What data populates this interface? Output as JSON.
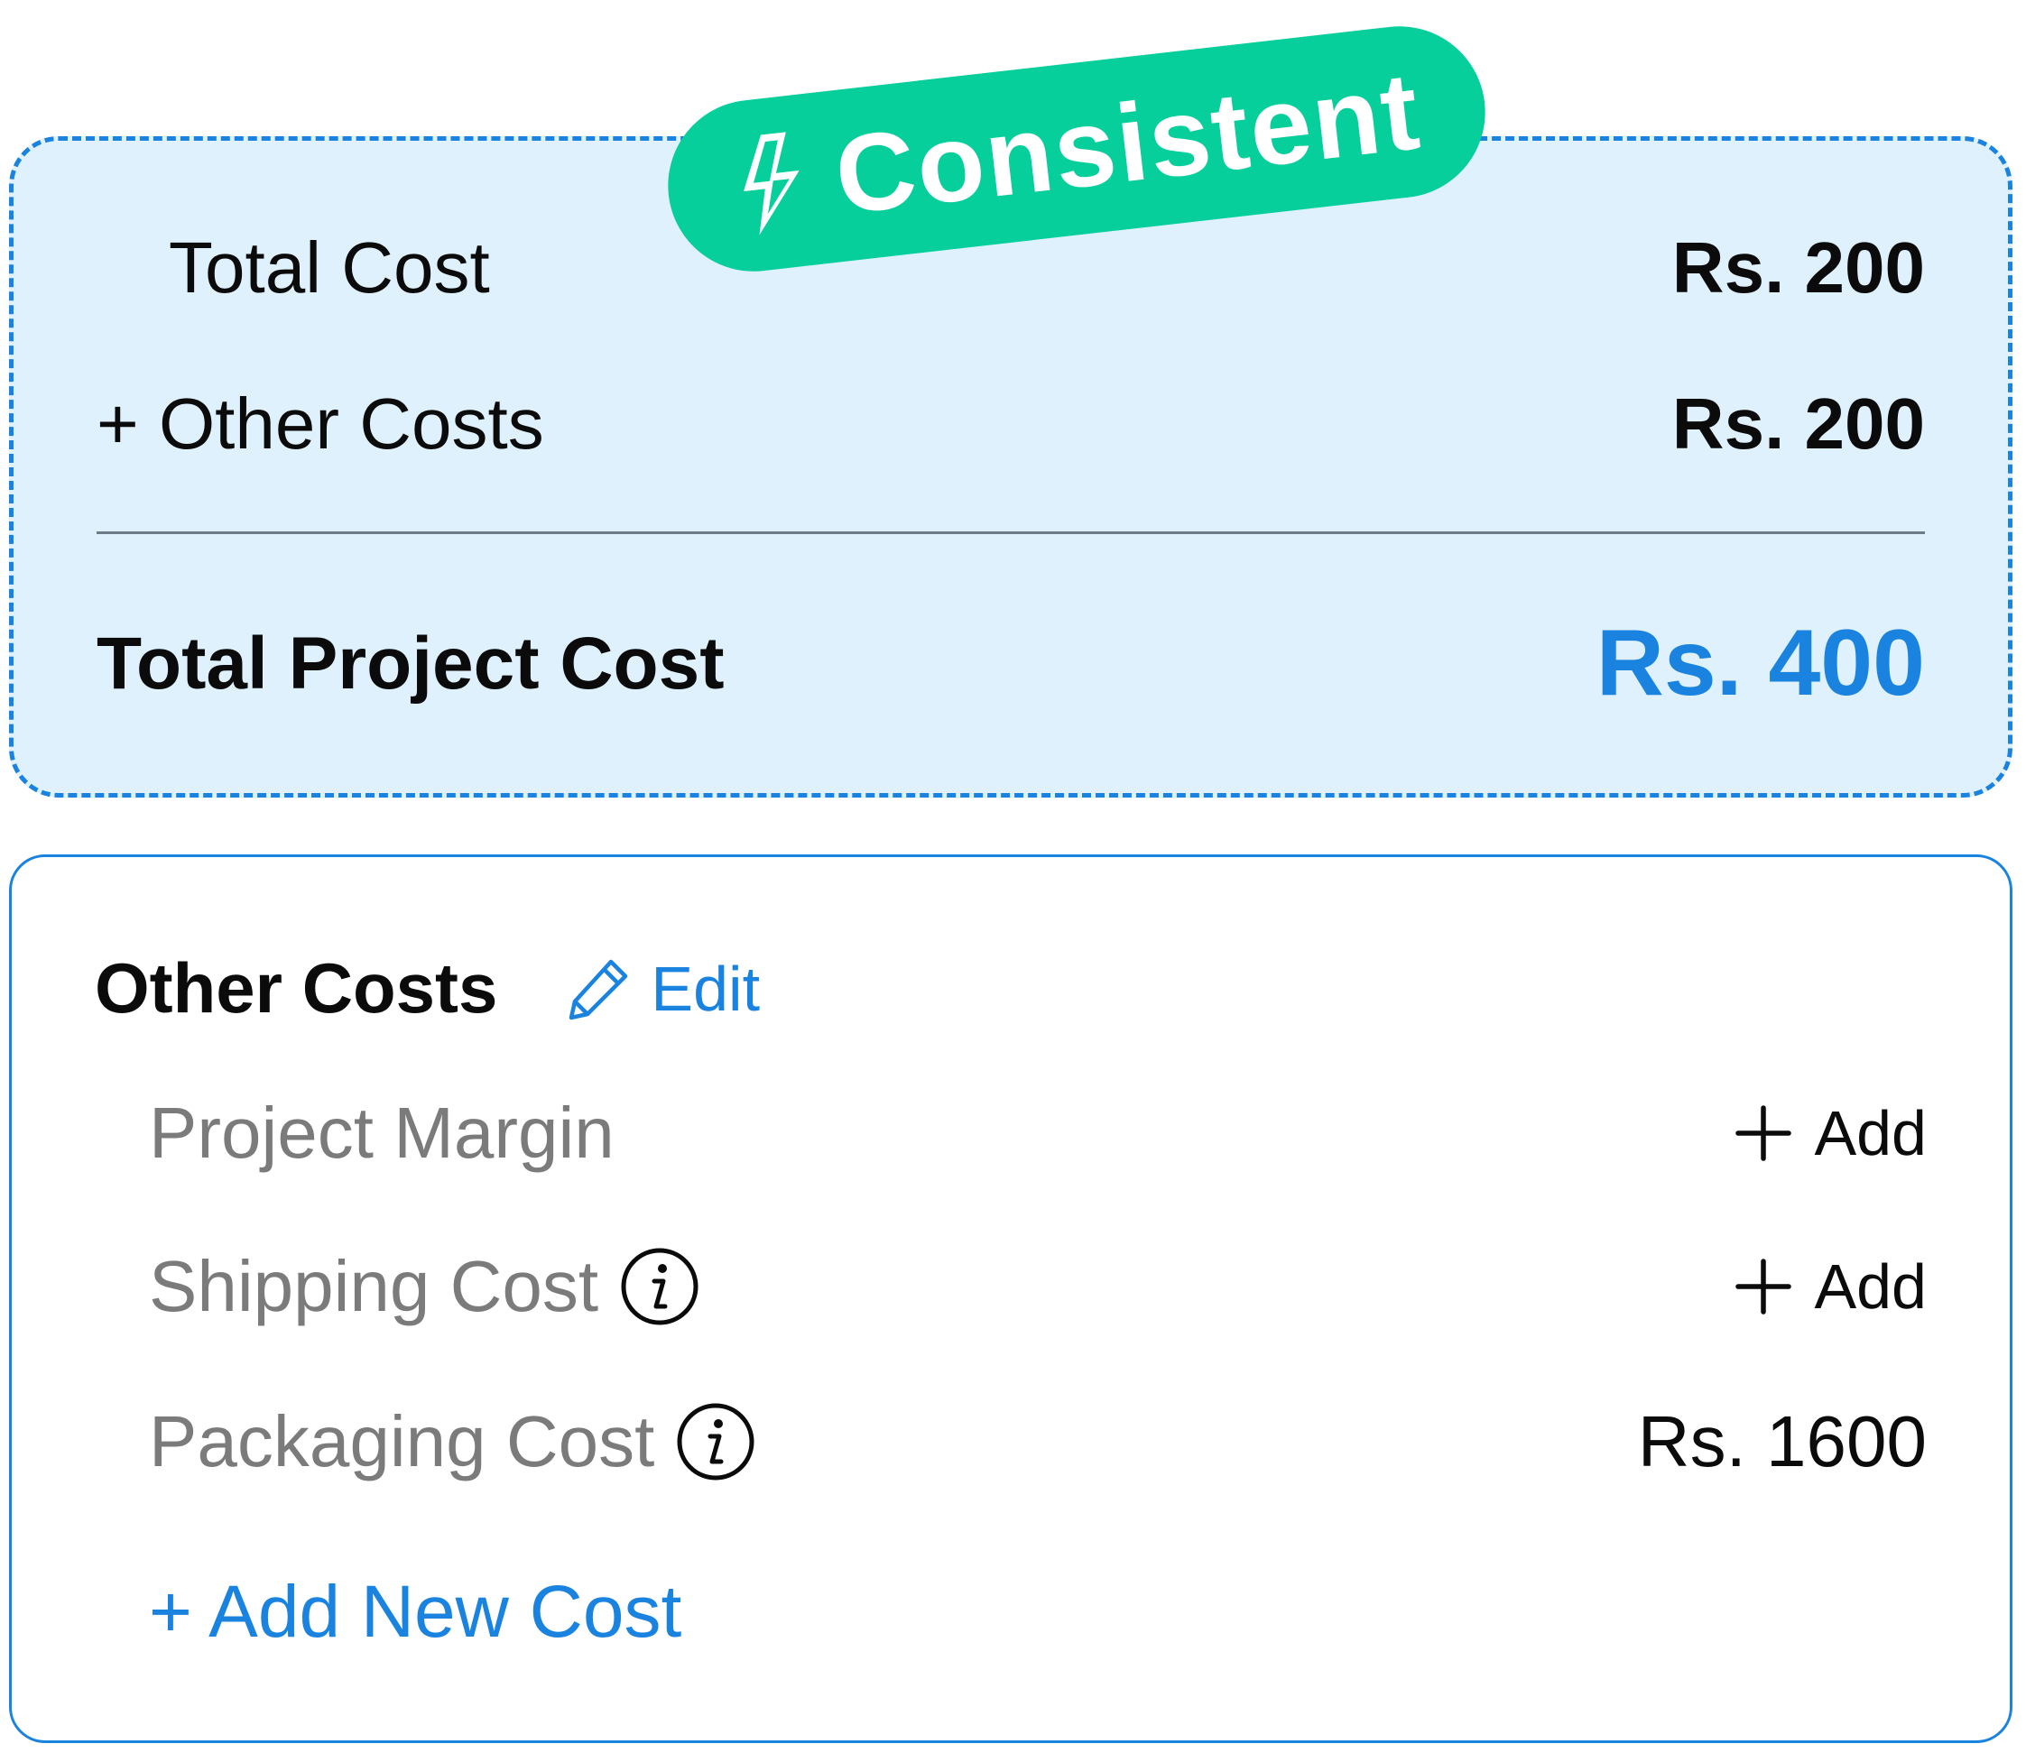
{
  "badge": {
    "label": "Consistent",
    "icon": "lightning-bolt-icon",
    "color": "#07cf9c"
  },
  "summary": {
    "total_cost_label": "Total Cost",
    "total_cost_value": "Rs. 200",
    "other_costs_label": "+ Other Costs",
    "other_costs_value": "Rs. 200",
    "total_project_cost_label": "Total Project Cost",
    "total_project_cost_value": "Rs. 400",
    "accent_color": "#1a83e0",
    "background_color": "#dff1fd"
  },
  "other_costs": {
    "title": "Other Costs",
    "edit_label": "Edit",
    "items": [
      {
        "label": "Project Margin",
        "action": "Add",
        "info": false
      },
      {
        "label": "Shipping Cost",
        "action": "Add",
        "info": true
      },
      {
        "label": "Packaging Cost",
        "value": "Rs. 1600",
        "info": true
      }
    ],
    "add_new_label": "+ Add New Cost"
  }
}
